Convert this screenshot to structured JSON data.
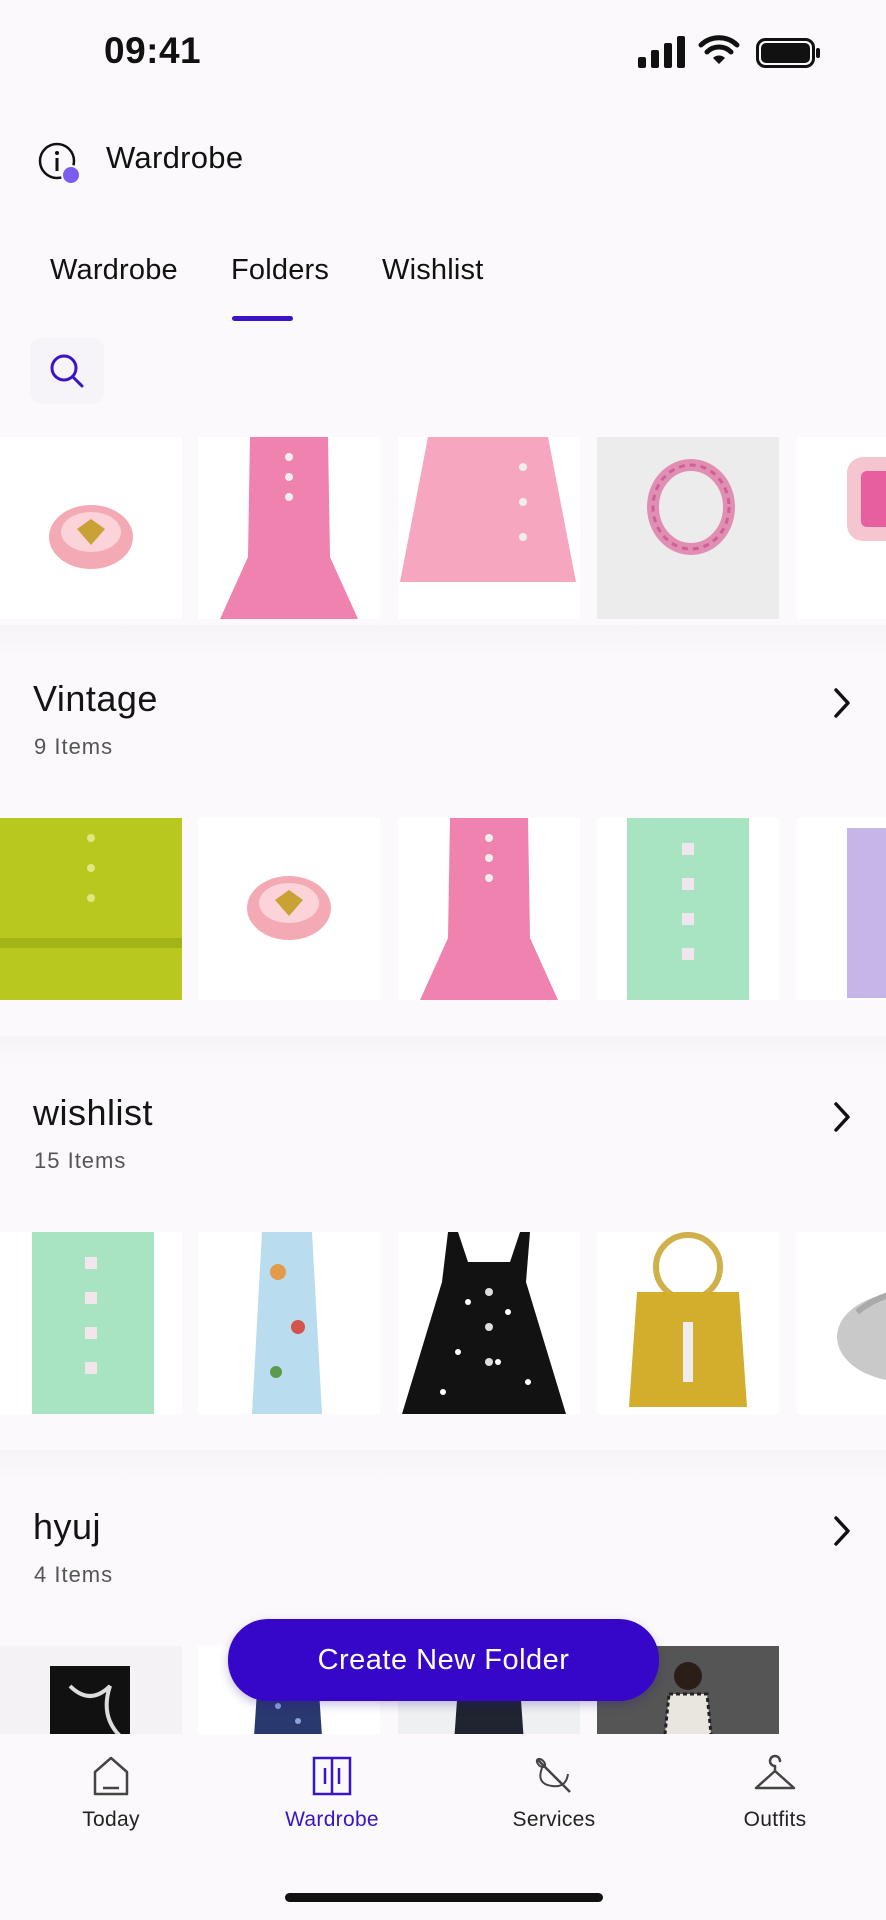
{
  "status": {
    "time": "09:41"
  },
  "header": {
    "title": "Wardrobe"
  },
  "tabs": [
    {
      "label": "Wardrobe"
    },
    {
      "label": "Folders"
    },
    {
      "label": "Wishlist"
    }
  ],
  "active_tab": "Folders",
  "folders": [
    {
      "name": "Vintage",
      "count": "9 Items"
    },
    {
      "name": "wishlist",
      "count": "15 Items"
    },
    {
      "name": "hyuj",
      "count": "4 Items"
    }
  ],
  "cta": {
    "label": "Create New Folder"
  },
  "nav": [
    {
      "label": "Today",
      "icon": "house-icon"
    },
    {
      "label": "Wardrobe",
      "icon": "wardrobe-icon"
    },
    {
      "label": "Services",
      "icon": "needle-thread-icon"
    },
    {
      "label": "Outfits",
      "icon": "hanger-icon"
    }
  ],
  "colors": {
    "accent": "#3606c9",
    "background": "#fbf9fb"
  }
}
